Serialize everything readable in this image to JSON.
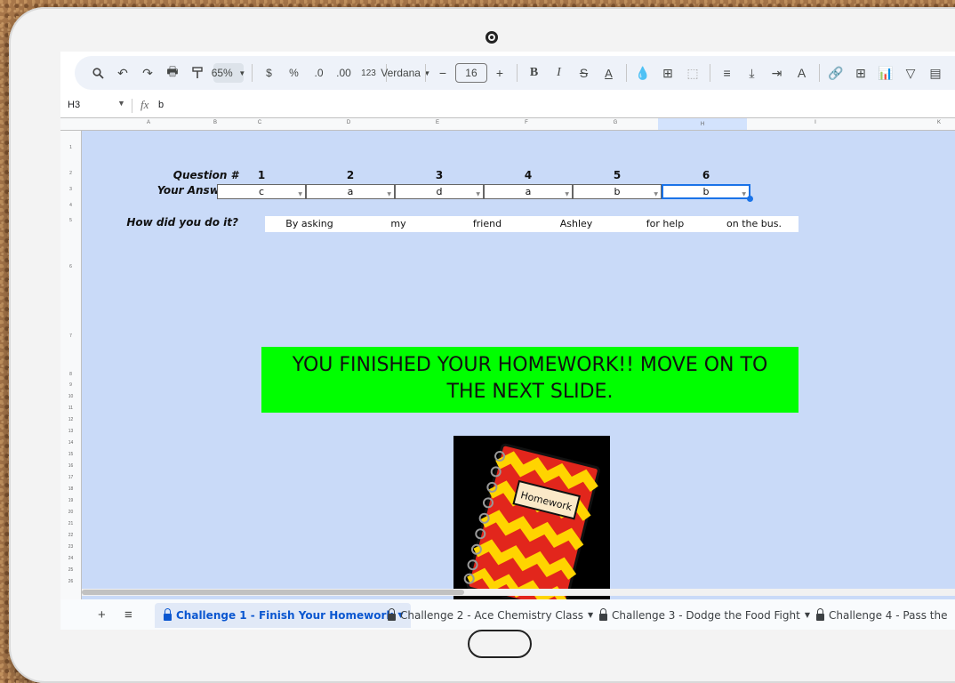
{
  "toolbar": {
    "zoom": "65%",
    "currency": "$",
    "percent": "%",
    "decrease_decimals": ".0",
    "increase_decimals": ".00",
    "number_format": "123",
    "font": "Verdana",
    "font_size": "16",
    "bold": "B",
    "italic": "I"
  },
  "formula_bar": {
    "cell_ref": "H3",
    "fx": "fx",
    "value": "b"
  },
  "columns": [
    "A",
    "B",
    "C",
    "D",
    "E",
    "F",
    "G",
    "H",
    "I",
    "K"
  ],
  "rows": [
    "1",
    "2",
    "3",
    "4",
    "5",
    "6",
    "7",
    "8",
    "9",
    "10",
    "11",
    "12",
    "13",
    "14",
    "15",
    "16",
    "17",
    "18",
    "19",
    "20",
    "21",
    "22",
    "23",
    "24",
    "25",
    "26"
  ],
  "sheet": {
    "question_label": "Question #",
    "answers_label": "Your Answers",
    "how_label": "How did you do it?",
    "questions": [
      "1",
      "2",
      "3",
      "4",
      "5",
      "6"
    ],
    "answers": [
      "c",
      "a",
      "d",
      "a",
      "b",
      "b"
    ],
    "how": [
      "By asking",
      "my",
      "friend",
      "Ashley",
      "for help",
      "on the bus."
    ],
    "banner_line1": "YOU FINISHED YOUR HOMEWORK!! MOVE ON TO",
    "banner_line2": "THE NEXT SLIDE.",
    "notebook_label": "Homework",
    "banner_color": "#00ff00",
    "sheet_bg": "#c9daf8"
  },
  "tabs": [
    {
      "label": "Challenge 1 - Finish Your Homework",
      "active": true
    },
    {
      "label": "Challenge 2 - Ace Chemistry Class",
      "active": false
    },
    {
      "label": "Challenge 3 - Dodge the Food Fight",
      "active": false
    },
    {
      "label": "Challenge 4 - Pass the",
      "active": false
    }
  ]
}
